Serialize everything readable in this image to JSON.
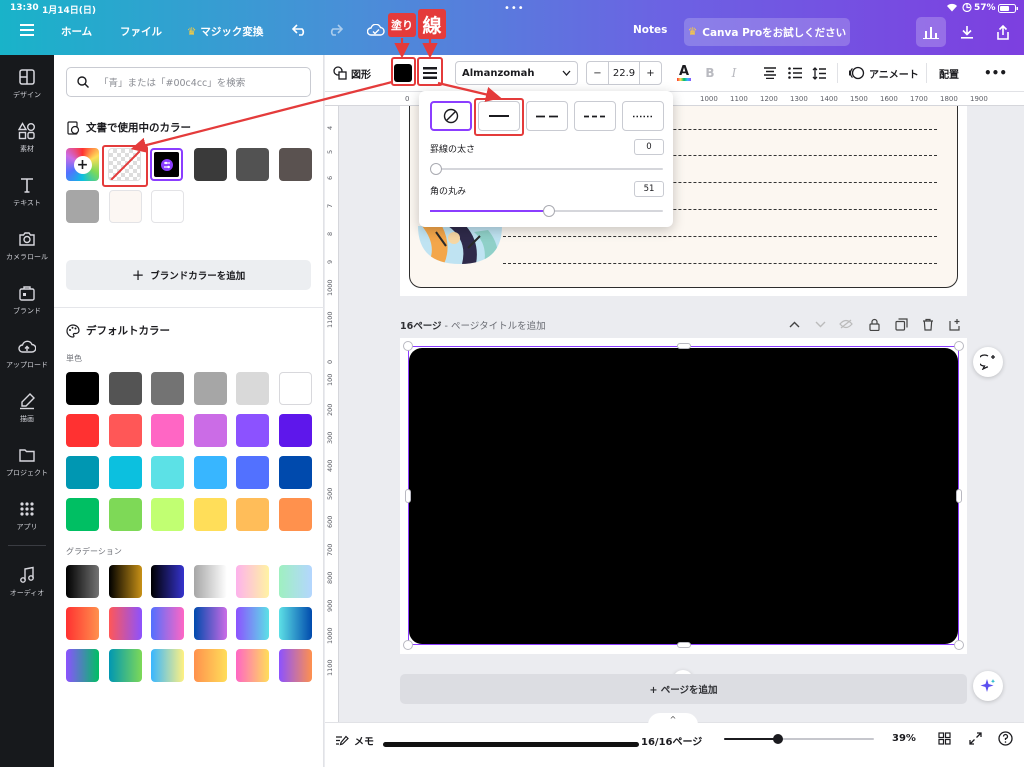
{
  "status": {
    "time": "13:30",
    "date": "1月14日(日)",
    "battery": "57%"
  },
  "topbar": {
    "menu_icon": "hamburger-icon",
    "home": "ホーム",
    "file": "ファイル",
    "magic": "マジック変換",
    "notes": "Notes",
    "pro": "Canva Proをお試しください"
  },
  "rail": [
    {
      "label": "デザイン",
      "icon": "design-icon"
    },
    {
      "label": "素材",
      "icon": "elements-icon"
    },
    {
      "label": "テキスト",
      "icon": "text-icon"
    },
    {
      "label": "カメラロール",
      "icon": "camera-icon"
    },
    {
      "label": "ブランド",
      "icon": "brand-icon"
    },
    {
      "label": "アップロード",
      "icon": "upload-icon"
    },
    {
      "label": "描画",
      "icon": "draw-icon"
    },
    {
      "label": "プロジェクト",
      "icon": "folder-icon"
    },
    {
      "label": "アプリ",
      "icon": "apps-icon"
    },
    {
      "label": "オーディオ",
      "icon": "music-icon"
    }
  ],
  "panel": {
    "search_placeholder": "「青」または「#00c4cc」を検索",
    "doc_colors_title": "文書で使用中のカラー",
    "doc_colors": [
      "#3a3a3a",
      "#525252",
      "#5a5250",
      "#a6a6a6",
      "#fcf7f3",
      "#ffffff"
    ],
    "brand_btn": "ブランドカラーを追加",
    "default_title": "デフォルトカラー",
    "solid_label": "単色",
    "solid_colors": [
      "#000000",
      "#545454",
      "#737373",
      "#a6a6a6",
      "#d9d9d9",
      "#ffffff",
      "#ff3131",
      "#ff5757",
      "#ff66c4",
      "#cb6ce6",
      "#8c52ff",
      "#5e17eb",
      "#0097b2",
      "#0cc0df",
      "#5ce1e6",
      "#38b6ff",
      "#5271ff",
      "#004aad",
      "#00bf63",
      "#7ed957",
      "#c1ff72",
      "#ffde59",
      "#ffbd59",
      "#ff914d"
    ],
    "gradient_label": "グラデーション",
    "gradients": [
      [
        "#000000",
        "#737373"
      ],
      [
        "#000000",
        "#c89116"
      ],
      [
        "#000000",
        "#3533cd"
      ],
      [
        "#a6a6a6",
        "#ffffff"
      ],
      [
        "#fdb2ec",
        "#fff3a3"
      ],
      [
        "#9ff0c0",
        "#b4d6ff"
      ],
      [
        "#ff3131",
        "#ff914d"
      ],
      [
        "#ff5757",
        "#8c52ff"
      ],
      [
        "#5170ff",
        "#ff66c4"
      ],
      [
        "#004aad",
        "#cb6ce6"
      ],
      [
        "#8c52ff",
        "#5ce1e6"
      ],
      [
        "#5de0e6",
        "#004aad"
      ],
      [
        "#8c52ff",
        "#00bf63"
      ],
      [
        "#0097b2",
        "#7ed957"
      ],
      [
        "#38b6ff",
        "#fff181"
      ],
      [
        "#ff914d",
        "#ffde59"
      ],
      [
        "#ff66c4",
        "#ffde59"
      ],
      [
        "#8c52ff",
        "#ff914d"
      ]
    ]
  },
  "toolbar": {
    "shape_label": "図形",
    "font": "Almanzomah",
    "font_size": "22.9",
    "minus": "−",
    "plus": "+",
    "bold": "B",
    "italic": "I",
    "animate": "アニメート",
    "position": "配置",
    "more": "•••"
  },
  "ruler_top": [
    "0",
    "1000",
    "1100",
    "1200",
    "1300",
    "1400",
    "1500",
    "1600",
    "1700",
    "1800",
    "1900"
  ],
  "ruler_left": [
    "4",
    "5",
    "6",
    "7",
    "8",
    "9",
    "1000",
    "1100",
    "0",
    "100",
    "200",
    "300",
    "400",
    "500",
    "600",
    "700",
    "800",
    "900",
    "1000",
    "1100"
  ],
  "popover": {
    "options": [
      "none",
      "solid",
      "dashed-long",
      "dashed-short",
      "dotted"
    ],
    "width_label": "罫線の太さ",
    "width_value": "0",
    "width_fraction": 0.0,
    "radius_label": "角の丸み",
    "radius_value": "51",
    "radius_fraction": 0.51
  },
  "page": {
    "title": "16ページ",
    "subtitle": " - ページタイトルを追加",
    "add_page": "+ ページを追加",
    "shape_color": "#000000"
  },
  "bottom": {
    "memo": "メモ",
    "pages": "16/16ページ",
    "zoom": "39%",
    "zoom_fraction": 0.36
  },
  "annotations": {
    "fill_label": "塗り",
    "stroke_label": "線",
    "color": "#e43b3b"
  },
  "colors": {
    "accent": "#8b3dff",
    "topbar_from": "#19b3c9",
    "topbar_to": "#7d3fe0"
  }
}
